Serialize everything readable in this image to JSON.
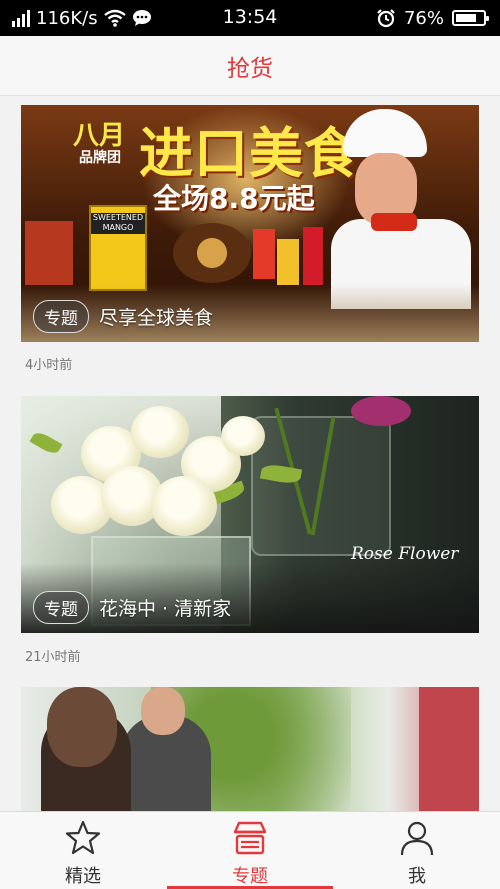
{
  "status_bar": {
    "speed": "116K/s",
    "time": "13:54",
    "battery": "76%",
    "battery_level": 0.76,
    "icons": [
      "signal-icon",
      "wifi-icon",
      "message-icon",
      "alarm-icon",
      "battery-icon"
    ]
  },
  "header": {
    "title": "抢货"
  },
  "feed": [
    {
      "tag": "专题",
      "title": "尽享全球美食",
      "time": "4小时前",
      "banner": {
        "month": "八月",
        "brand": "品牌团",
        "headline": "进口美食",
        "promo": "全场8.8元起",
        "product_text": "SWEETENED MANGO"
      }
    },
    {
      "tag": "专题",
      "title": "花海中 · 清新家",
      "time": "21小时前",
      "banner": {
        "script": "Rose Flower"
      }
    },
    {
      "tag": "",
      "title": "",
      "time": ""
    }
  ],
  "tabbar": {
    "tabs": [
      {
        "label": "精选",
        "icon": "star-icon",
        "active": false
      },
      {
        "label": "专题",
        "icon": "shop-icon",
        "active": true
      },
      {
        "label": "我",
        "icon": "person-icon",
        "active": false
      }
    ]
  },
  "colors": {
    "accent": "#e4393c",
    "status_bar": "#000000",
    "background": "#f2f2f2"
  }
}
